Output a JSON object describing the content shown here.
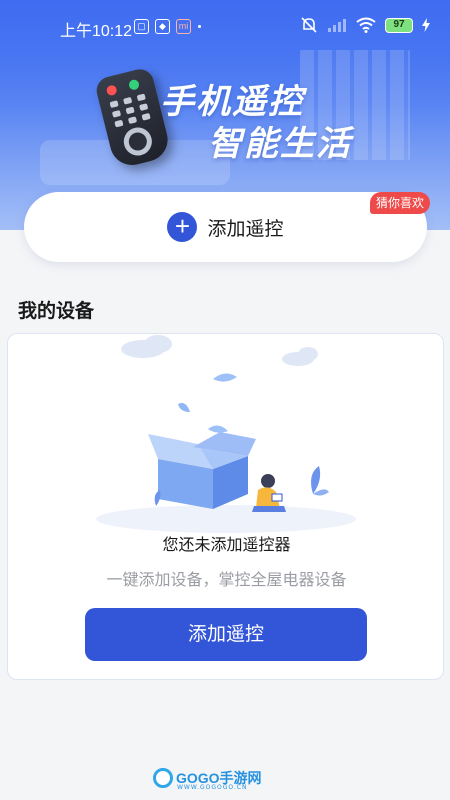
{
  "status_bar": {
    "time": "上午10:12",
    "icons": [
      "app-icon-green",
      "shield-icon",
      "mi-icon"
    ],
    "mi_label": "mi",
    "battery": "97"
  },
  "banner": {
    "slogan_line1": "手机遥控",
    "slogan_line2": "智能生活"
  },
  "add_card": {
    "label": "添加遥控",
    "tag": "猜你喜欢"
  },
  "devices": {
    "section_title": "我的设备",
    "empty_title": "您还未添加遥控器",
    "empty_subtitle": "一键添加设备，掌控全屋电器设备",
    "add_button": "添加遥控"
  },
  "watermark": {
    "text": "GOGO手游网",
    "subtext": "WWW.GOGOGO.CN"
  },
  "colors": {
    "primary": "#3356d8",
    "tag": "#ef4a4a",
    "banner_top": "#3f6cf1"
  }
}
